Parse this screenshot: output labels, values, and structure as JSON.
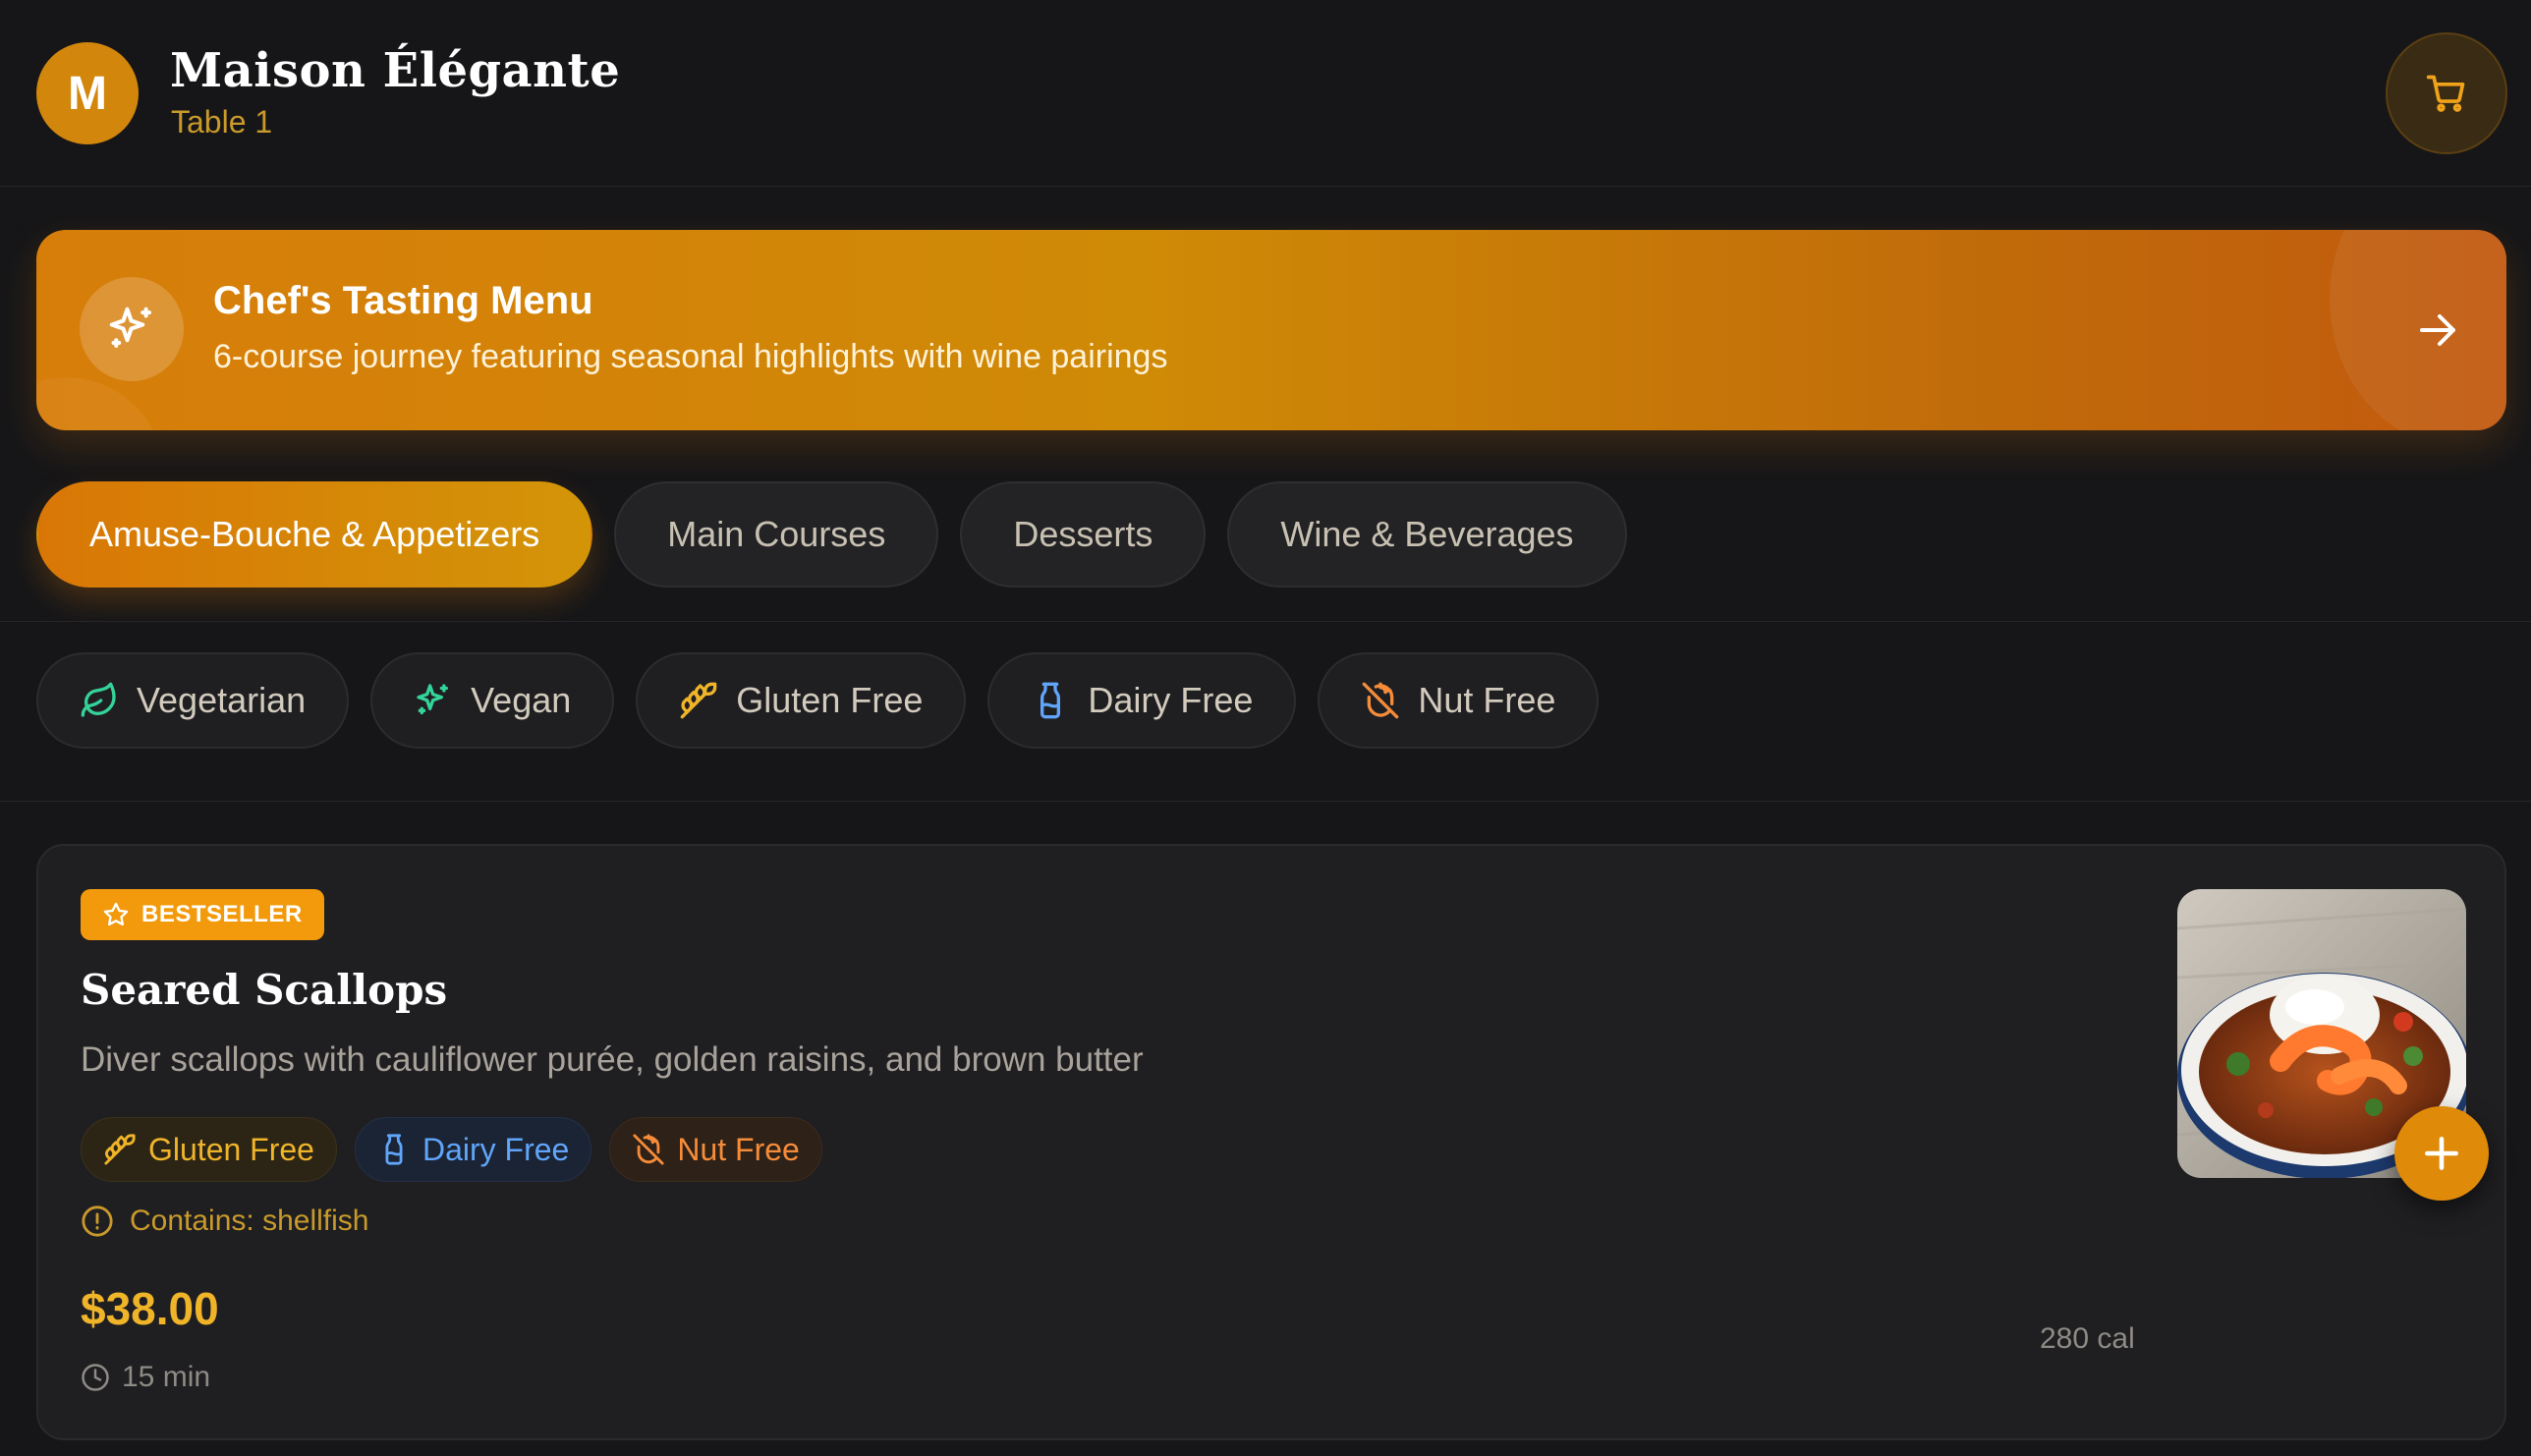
{
  "header": {
    "logo_letter": "M",
    "restaurant_name": "Maison Élégante",
    "table_label": "Table 1",
    "cart_icon": "cart-icon"
  },
  "promo": {
    "icon": "sparkles-icon",
    "title": "Chef's Tasting Menu",
    "subtitle": "6-course journey featuring seasonal highlights with wine pairings",
    "arrow_icon": "arrow-right-icon"
  },
  "tabs": [
    {
      "label": "Amuse-Bouche & Appetizers",
      "active": true
    },
    {
      "label": "Main Courses",
      "active": false
    },
    {
      "label": "Desserts",
      "active": false
    },
    {
      "label": "Wine & Beverages",
      "active": false
    }
  ],
  "filters": [
    {
      "label": "Vegetarian",
      "icon": "leaf-icon",
      "color": "#34d399"
    },
    {
      "label": "Vegan",
      "icon": "sparkles-icon",
      "color": "#34d399"
    },
    {
      "label": "Gluten Free",
      "icon": "wheat-icon",
      "color": "#f0b429"
    },
    {
      "label": "Dairy Free",
      "icon": "milk-icon",
      "color": "#60a5fa"
    },
    {
      "label": "Nut Free",
      "icon": "nut-off-icon",
      "color": "#f58c3a"
    }
  ],
  "dish": {
    "badge": "BESTSELLER",
    "badge_icon": "star-icon",
    "name": "Seared Scallops",
    "description": "Diver scallops with cauliflower purée, golden raisins, and brown butter",
    "tags": [
      {
        "label": "Gluten Free",
        "icon": "wheat-icon"
      },
      {
        "label": "Dairy Free",
        "icon": "milk-icon"
      },
      {
        "label": "Nut Free",
        "icon": "nut-off-icon"
      }
    ],
    "allergen": "Contains: shellfish",
    "price": "$38.00",
    "prep_time": "15 min",
    "calories": "280 cal",
    "image_alt": "dish-photo"
  },
  "colors": {
    "accent": "#d97706",
    "background": "#161618",
    "card": "#1f1f22",
    "price": "#f0b429"
  }
}
